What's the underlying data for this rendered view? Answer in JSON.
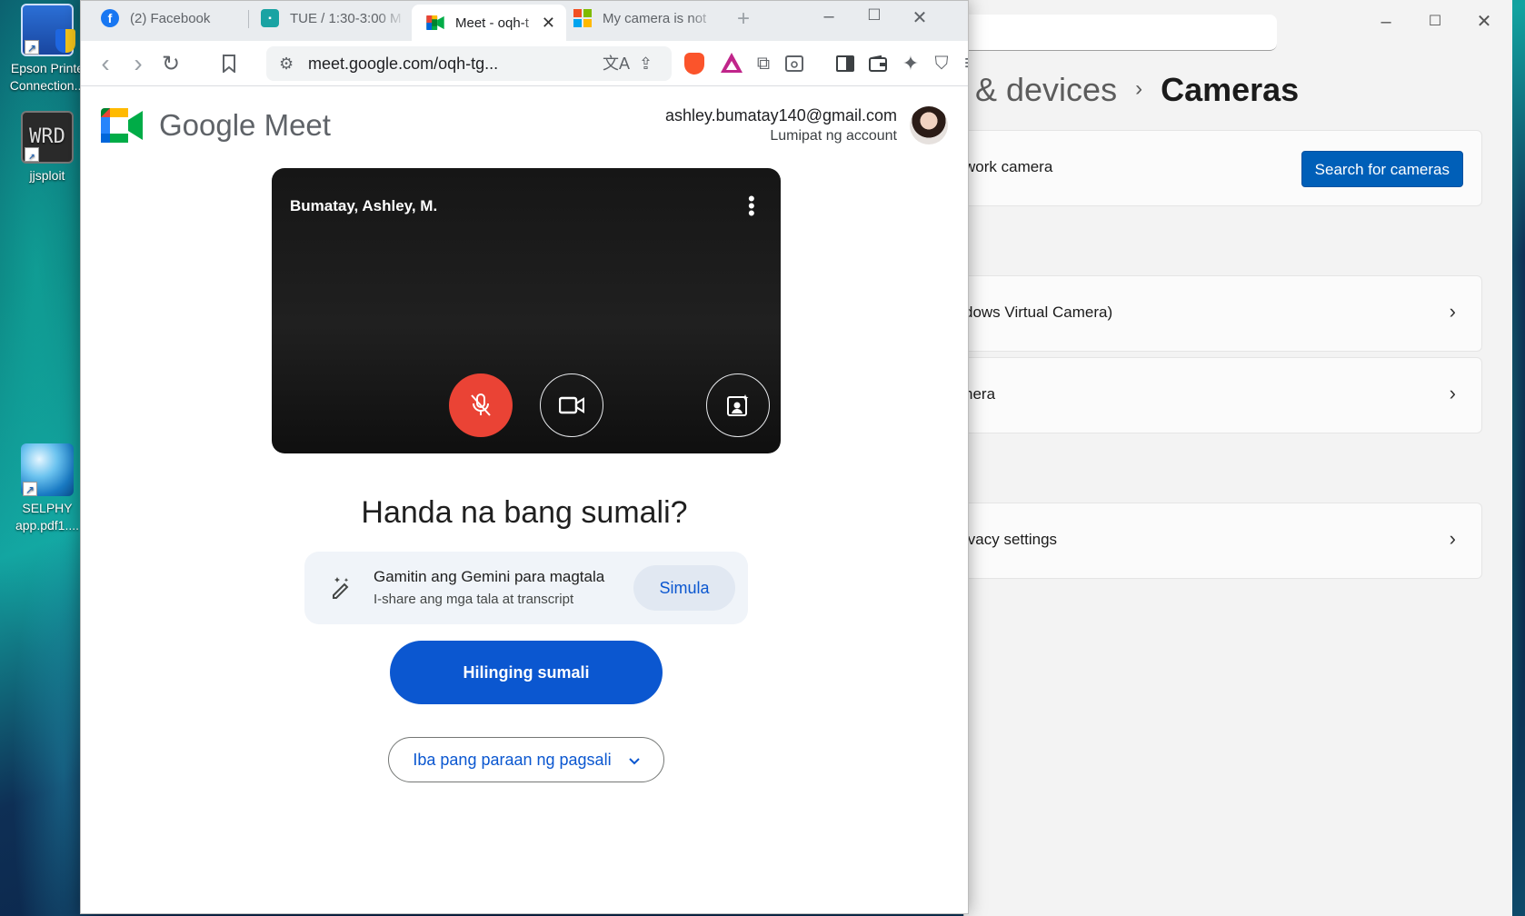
{
  "desktop": {
    "icons": [
      {
        "label": "Epson Printe Connection..."
      },
      {
        "label": "jjsploit",
        "glyph": "WRD"
      },
      {
        "label": "SELPHY app.pdf1...."
      }
    ]
  },
  "settings": {
    "crumb_parent": "& devices",
    "crumb_sep": "›",
    "crumb_current": "Cameras",
    "rows": [
      {
        "label": "work camera",
        "button": "Search for cameras"
      },
      {
        "label": "dows Virtual Camera)",
        "chevron": "›"
      },
      {
        "label": "nera",
        "chevron": "›"
      },
      {
        "label": "ivacy settings",
        "chevron": "›"
      }
    ],
    "win_minimize": "–",
    "win_maximize": "☐",
    "win_close": "✕"
  },
  "browser": {
    "tabs": [
      {
        "label": "(2) Facebook",
        "fav": "f",
        "fav_color": "#1877f2"
      },
      {
        "label": "TUE / 1:30-3:00 M",
        "fav": "▪",
        "fav_color": "#1aa3a3"
      },
      {
        "label": "Meet - oqh-t",
        "fav": "",
        "active": true,
        "close": "✕"
      },
      {
        "label": "My camera is not",
        "fav": "",
        "fav_color": "#f25022"
      }
    ],
    "new_tab": "+",
    "win_minimize": "–",
    "win_maximize": "☐",
    "win_close": "✕",
    "url": "meet.google.com/oqh-tg...",
    "icons": {
      "back": "‹",
      "forward": "›",
      "reload": "↻",
      "bookmark": "🔖",
      "site_settings": "⚙",
      "translate": "文A",
      "share": "⇪",
      "extensions": "⧉",
      "sidebar": "▮",
      "wallet": "▭",
      "leo": "✦",
      "vpn": "⛉",
      "menu": "≡"
    }
  },
  "meet": {
    "brand": "Google Meet",
    "account_email": "ashley.bumatay140@gmail.com",
    "switch_account": "Lumipat ng account",
    "preview_name": "Bumatay, Ashley, M.",
    "ready_heading": "Handa na bang sumali?",
    "gemini_title": "Gamitin ang Gemini para magtala",
    "gemini_subtitle": "I-share ang mga tala at transcript",
    "gemini_start": "Simula",
    "join_button": "Hilinging sumali",
    "other_ways": "Iba pang paraan ng pagsali",
    "colors": {
      "accent": "#0b57d0",
      "mic_off": "#ea4335"
    }
  }
}
